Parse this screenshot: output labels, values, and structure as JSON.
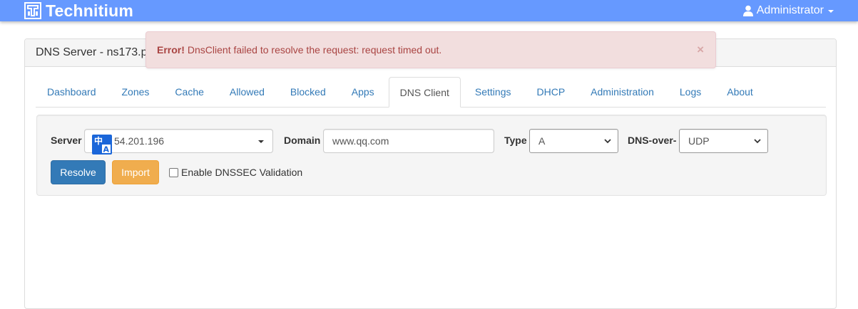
{
  "navbar": {
    "brand": "Technitium",
    "user": "Administrator"
  },
  "panel": {
    "heading": "DNS Server - ns173.p"
  },
  "alert": {
    "title": "Error!",
    "message": "DnsClient failed to resolve the request: request timed out.",
    "close": "×"
  },
  "tabs": [
    {
      "label": "Dashboard",
      "active": false
    },
    {
      "label": "Zones",
      "active": false
    },
    {
      "label": "Cache",
      "active": false
    },
    {
      "label": "Allowed",
      "active": false
    },
    {
      "label": "Blocked",
      "active": false
    },
    {
      "label": "Apps",
      "active": false
    },
    {
      "label": "DNS Client",
      "active": true
    },
    {
      "label": "Settings",
      "active": false
    },
    {
      "label": "DHCP",
      "active": false
    },
    {
      "label": "Administration",
      "active": false
    },
    {
      "label": "Logs",
      "active": false
    },
    {
      "label": "About",
      "active": false
    }
  ],
  "form": {
    "server_label": "Server",
    "server_value": "54.201.196",
    "domain_label": "Domain",
    "domain_value": "www.qq.com",
    "type_label": "Type",
    "type_value": "A",
    "protocol_label": "DNS-over-",
    "protocol_value": "UDP",
    "resolve_label": "Resolve",
    "import_label": "Import",
    "dnssec_label": "Enable DNSSEC Validation",
    "dnssec_checked": false
  },
  "overlay": {
    "translate_glyph_top": "中",
    "translate_glyph_bottom": "A"
  },
  "colors": {
    "navbar": "#6699ff",
    "primary": "#337ab7",
    "warning": "#f0ad4e",
    "danger_text": "#a94442",
    "danger_bg": "#f2dede"
  }
}
